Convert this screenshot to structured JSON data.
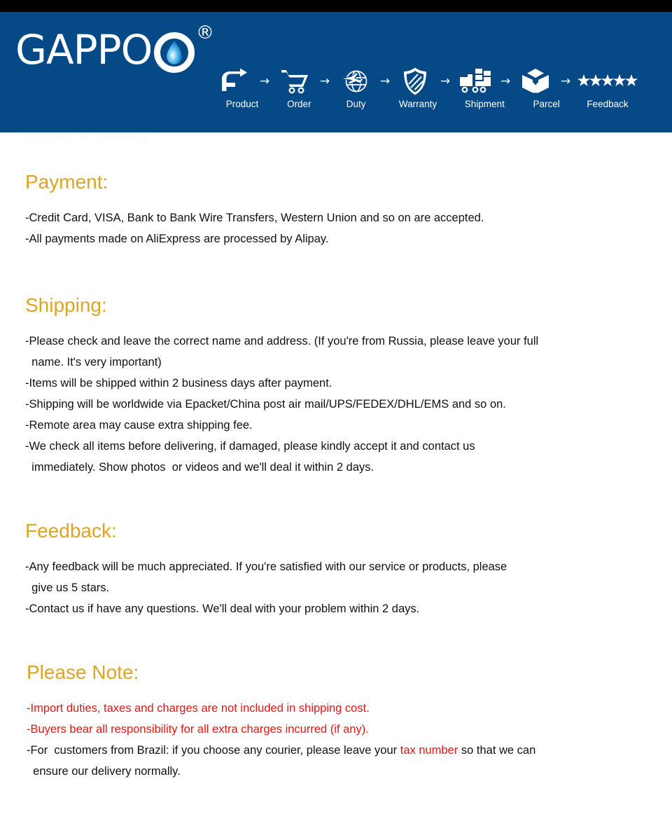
{
  "colors": {
    "top_bar": "#000000",
    "banner_blue": "#054a87",
    "heading_gold": "#dda521",
    "body_black": "#111111",
    "alert_red": "#ee1111",
    "logo_white": "#ffffff"
  },
  "banner": {
    "brand": "GAPPO",
    "registered_mark": "®",
    "logo_icon": "water-drop-icon",
    "flow": {
      "arrow": "→",
      "steps": [
        {
          "label": "Product",
          "icon": "faucet-icon"
        },
        {
          "label": "Order",
          "icon": "shopping-cart-icon"
        },
        {
          "label": "Duty",
          "icon": "globe-airplane-icon"
        },
        {
          "label": "Warranty",
          "icon": "shield-icon"
        },
        {
          "label": "Shipment",
          "icon": "delivery-truck-icon"
        },
        {
          "label": "Parcel",
          "icon": "open-box-icon"
        },
        {
          "label": "Feedback",
          "icon": "five-stars-icon"
        }
      ]
    }
  },
  "ghost_text": "Payment & Shipping",
  "sections": {
    "payment": {
      "title": "Payment:",
      "lines": [
        "-Credit Card, VISA, Bank to Bank Wire Transfers, Western Union and so on are accepted.",
        "-All payments made on AliExpress are processed by Alipay."
      ]
    },
    "shipping": {
      "title": "Shipping:",
      "lines": [
        "-Please check and leave the correct name and address. (If you're from Russia, please leave your full",
        "  name. It's very important)",
        "-Items will be shipped within 2 business days after payment.",
        "-Shipping will be worldwide via Epacket/China post air mail/UPS/FEDEX/DHL/EMS and so on.",
        "-Remote area may cause extra shipping fee.",
        "-We check all items before delivering, if damaged, please kindly accept it and contact us",
        "  immediately. Show photos  or videos and we'll deal it within 2 days."
      ]
    },
    "feedback": {
      "title": "Feedback:",
      "lines": [
        "-Any feedback will be much appreciated. If you're satisfied with our service or products, please",
        "  give us 5 stars.",
        "-Contact us if have any questions. We'll deal with your problem within 2 days."
      ]
    },
    "please_note": {
      "title": "Please Note:",
      "lines": [
        {
          "text": "-Import duties, taxes and charges are not included in shipping cost.",
          "color": "red"
        },
        {
          "text": "-Buyers bear all responsibility for all extra charges incurred (if any).",
          "color": "red"
        }
      ],
      "brazil_line": {
        "part1": "-For  customers from Brazil: if you choose any courier, please leave your ",
        "highlight": "tax number",
        "part2": " so that we can",
        "continuation": "  ensure our delivery normally."
      }
    }
  }
}
